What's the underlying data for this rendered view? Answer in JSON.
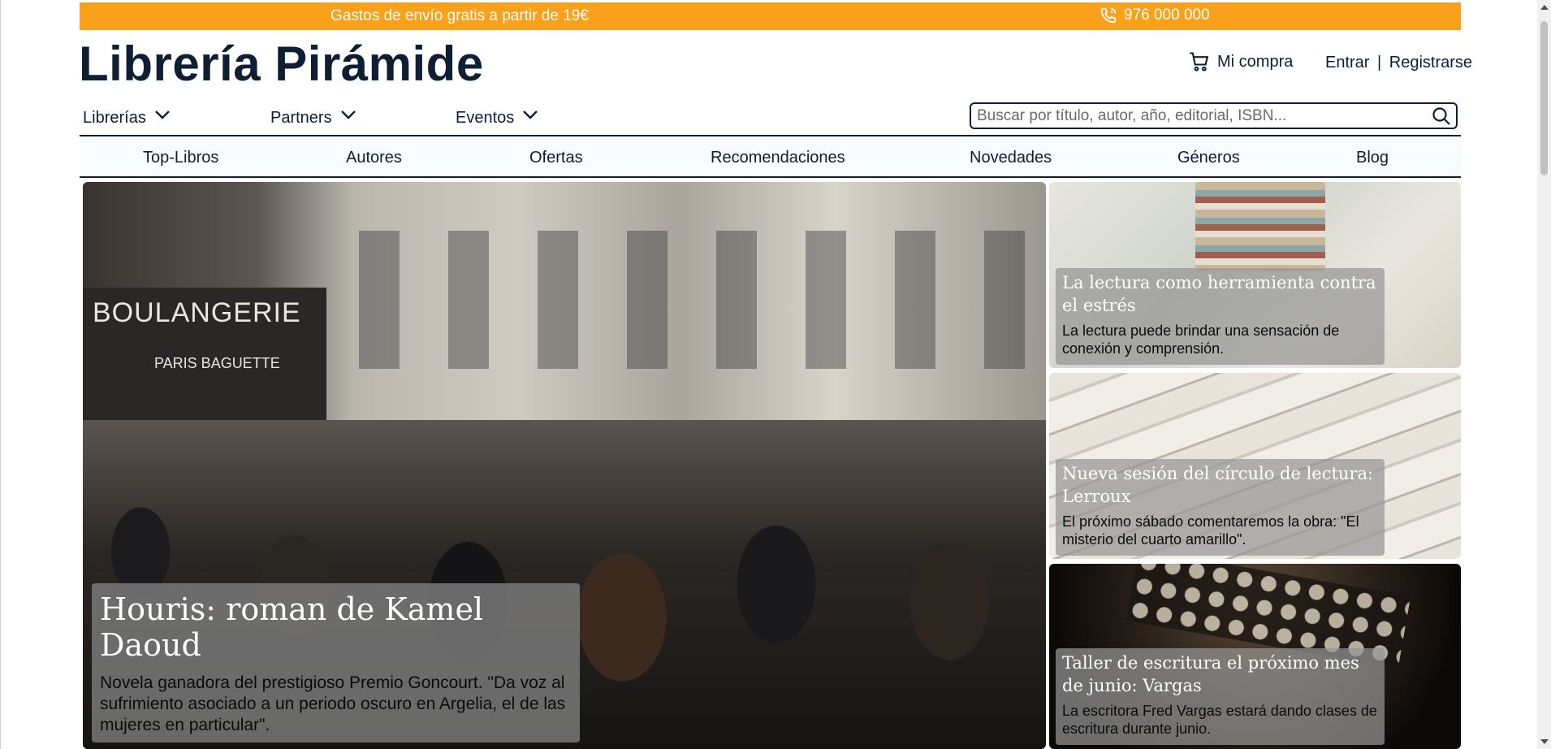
{
  "topbar": {
    "shipping_text": "Gastos de envío gratis a partir de 19€",
    "phone": "976 000 000",
    "background": "#f9a11b"
  },
  "header": {
    "logo": "Librería Pirámide",
    "cart_label": "Mi compra",
    "login_label": "Entrar",
    "separator": "|",
    "register_label": "Registrarse"
  },
  "dropdowns": [
    {
      "label": "Librerías"
    },
    {
      "label": "Partners"
    },
    {
      "label": "Eventos"
    }
  ],
  "search": {
    "placeholder": "Buscar por título, autor, año, editorial, ISBN...",
    "value": ""
  },
  "nav": [
    {
      "label": "Top-Libros"
    },
    {
      "label": "Autores"
    },
    {
      "label": "Ofertas"
    },
    {
      "label": "Recomendaciones"
    },
    {
      "label": "Novedades"
    },
    {
      "label": "Géneros"
    },
    {
      "label": "Blog"
    }
  ],
  "hero": {
    "image_text_1": "BOULANGERIE",
    "image_text_2": "PARIS BAGUETTE",
    "title": "Houris: roman de Kamel Daoud",
    "description": "Novela ganadora del prestigioso Premio Goncourt. \"Da voz al sufrimiento asociado a un periodo oscuro en Argelia, el de las mujeres en particular\"."
  },
  "side_cards": [
    {
      "title": "La lectura como herramienta contra el estrés",
      "description": "La lectura puede brindar una sensación de conexión y comprensión."
    },
    {
      "title": "Nueva sesión del círculo de lectura: Lerroux",
      "description": "El próximo sábado comentaremos la obra: \"El misterio del cuarto amarillo\"."
    },
    {
      "title": "Taller de escritura el próximo mes de junio: Vargas",
      "description": "La escritora Fred Vargas estará dando clases de escritura durante junio."
    }
  ],
  "icons": {
    "phone": "phone-icon",
    "cart": "cart-icon",
    "search": "search-icon",
    "chevron": "chevron-down-icon"
  },
  "colors": {
    "brand_dark": "#0e1f33",
    "accent": "#f9a11b"
  }
}
